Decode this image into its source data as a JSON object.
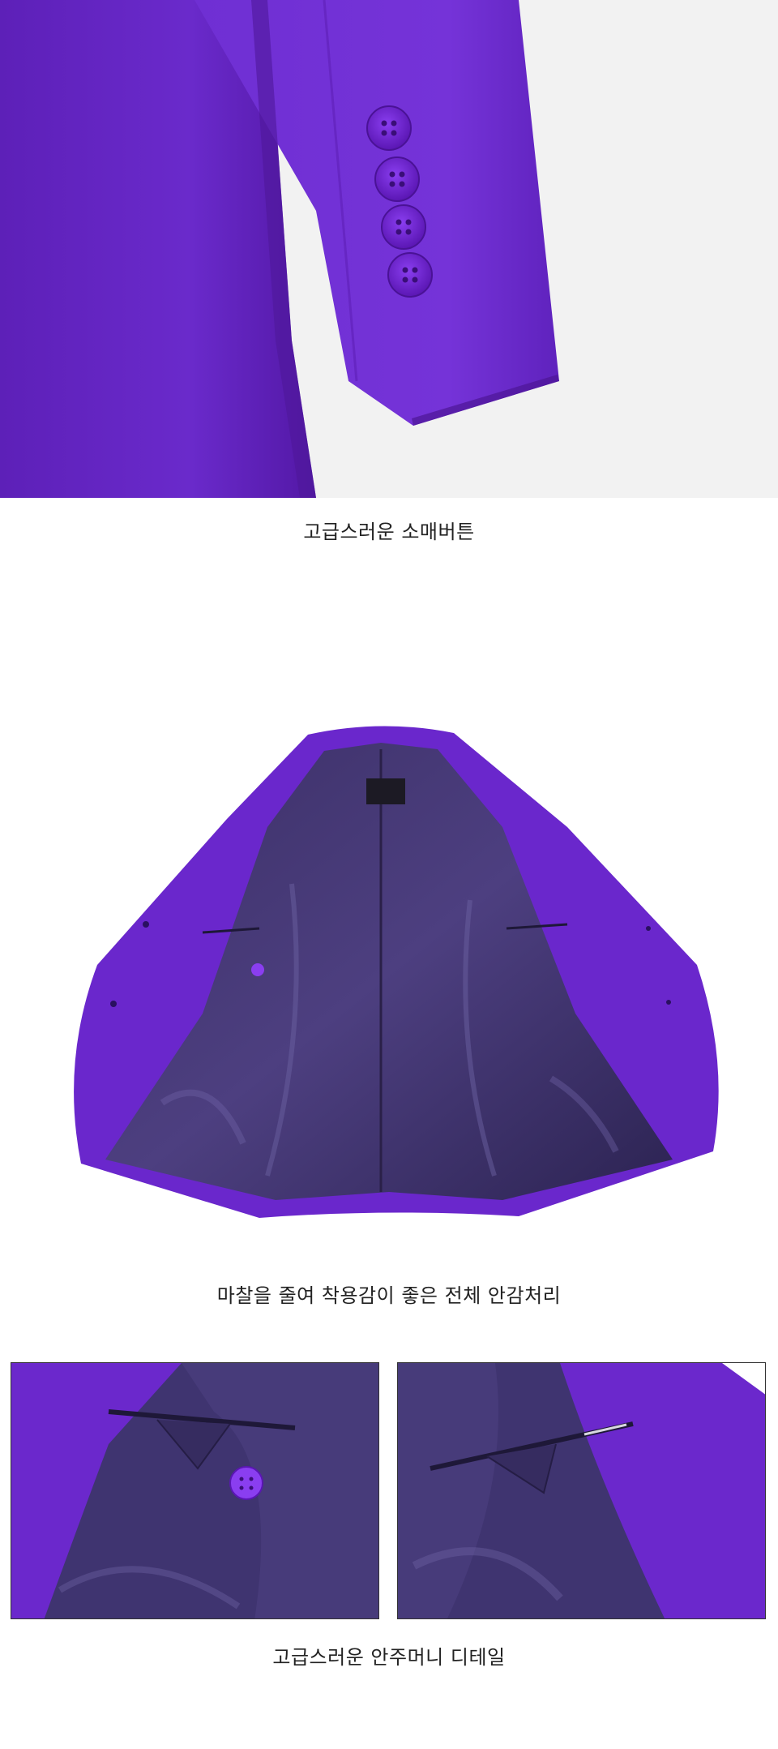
{
  "sections": [
    {
      "caption": "고급스러운 소매버튼"
    },
    {
      "caption": "마찰을 줄여 착용감이 좋은 전체 안감처리"
    },
    {
      "caption": "고급스러운 안주머니 디테일"
    }
  ],
  "colors": {
    "fabric_purple": "#6a28c9",
    "fabric_dark": "#4b1c99",
    "lining_dark": "#2f2550",
    "lining_mid": "#4a3c78",
    "background": "#ffffff",
    "photo_bg": "#f2f2f2"
  }
}
